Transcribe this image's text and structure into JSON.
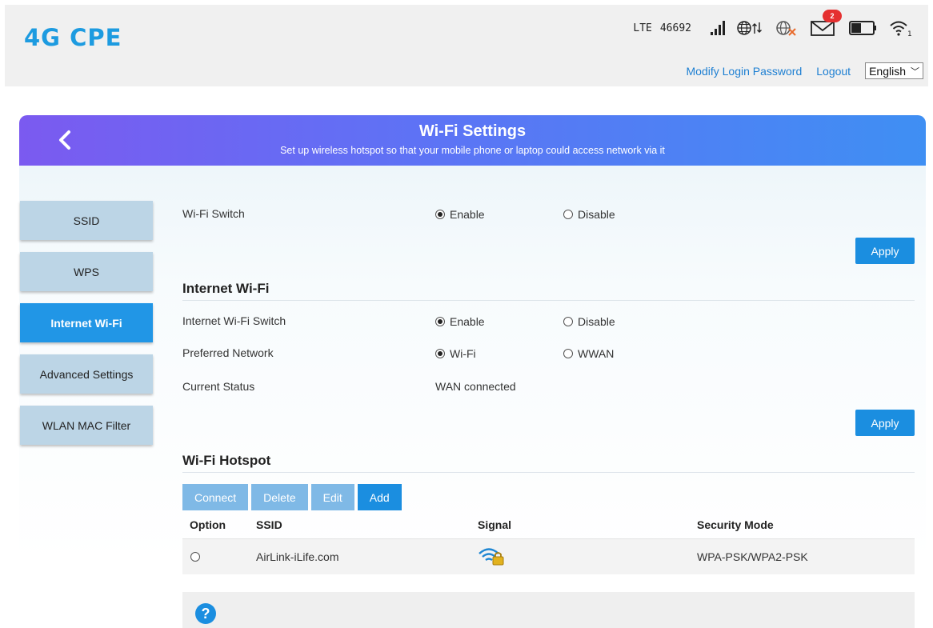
{
  "header": {
    "logo": "4G CPE",
    "network_type": "LTE",
    "operator_code": "46692",
    "message_count": "2",
    "links": {
      "modify_password": "Modify Login Password",
      "logout": "Logout"
    },
    "language": "English"
  },
  "banner": {
    "title": "Wi-Fi Settings",
    "subtitle": "Set up wireless hotspot so that your mobile phone or laptop could access network via it"
  },
  "sidebar": {
    "items": [
      {
        "label": "SSID"
      },
      {
        "label": "WPS"
      },
      {
        "label": "Internet Wi-Fi",
        "active": true
      },
      {
        "label": "Advanced Settings"
      },
      {
        "label": "WLAN MAC Filter"
      }
    ]
  },
  "wifi_switch": {
    "label": "Wi-Fi Switch",
    "enable": "Enable",
    "disable": "Disable",
    "selected": "Enable"
  },
  "apply_label": "Apply",
  "internet_wifi": {
    "title": "Internet Wi-Fi",
    "switch_label": "Internet Wi-Fi Switch",
    "switch_enable": "Enable",
    "switch_disable": "Disable",
    "switch_selected": "Enable",
    "preferred_label": "Preferred Network",
    "preferred_wifi": "Wi-Fi",
    "preferred_wwan": "WWAN",
    "preferred_selected": "Wi-Fi",
    "status_label": "Current Status",
    "status_value": "WAN connected"
  },
  "hotspot": {
    "title": "Wi-Fi Hotspot",
    "buttons": {
      "connect": "Connect",
      "delete": "Delete",
      "edit": "Edit",
      "add": "Add"
    },
    "columns": [
      "Option",
      "SSID",
      "Signal",
      "Security Mode"
    ],
    "rows": [
      {
        "ssid": "AirLink-iLife.com",
        "signal_icon": "wifi-locked-icon",
        "security": "WPA-PSK/WPA2-PSK"
      }
    ]
  },
  "help_icon": "?",
  "colors": {
    "accent": "#1b8ee0",
    "logo": "#1d9be0",
    "banner_start": "#7b5af0",
    "banner_end": "#3f8ff3",
    "badge": "#e53030"
  }
}
